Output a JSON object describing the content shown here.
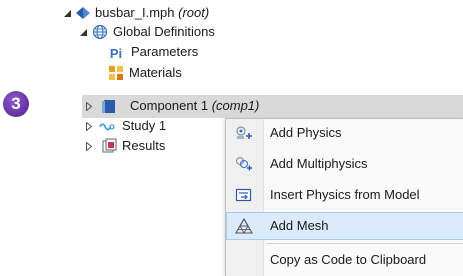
{
  "tree": {
    "root": {
      "label": "busbar_I.mph",
      "suffix": "(root)"
    },
    "global_definitions": {
      "label": "Global Definitions"
    },
    "parameters": {
      "label": "Parameters",
      "icon_text": "Pi"
    },
    "materials": {
      "label": "Materials"
    },
    "component": {
      "label": "Component 1",
      "suffix": "(comp1)"
    },
    "study": {
      "label": "Study 1"
    },
    "results": {
      "label": "Results"
    }
  },
  "step_badge": {
    "number": "3"
  },
  "context_menu": {
    "items": [
      {
        "label": "Add Physics",
        "icon": "add-physics-icon"
      },
      {
        "label": "Add Multiphysics",
        "icon": "add-multiphysics-icon"
      },
      {
        "label": "Insert Physics from Model",
        "icon": "insert-physics-icon"
      },
      {
        "label": "Add Mesh",
        "icon": "mesh-icon"
      },
      {
        "label": "Copy as Code to Clipboard",
        "icon": ""
      }
    ]
  },
  "colors": {
    "accent_purple": "#6a35a8",
    "hover_blue": "#dcebfc",
    "selection_gray": "#d9d9d9"
  }
}
